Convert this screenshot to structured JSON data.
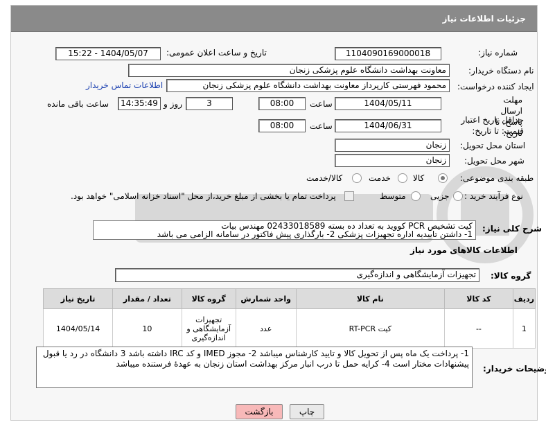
{
  "header": {
    "title": "جزئیات اطلاعات نیاز"
  },
  "form": {
    "need_number_label": "شماره نیاز:",
    "need_number": "1104090169000018",
    "announce_label": "تاریخ و ساعت اعلان عمومی:",
    "announce_value": "1404/05/07 - 15:22",
    "buyer_org_label": "نام دستگاه خریدار:",
    "buyer_org": "معاونت بهداشت دانشگاه علوم پزشکی زنجان",
    "creator_label": "ایجاد کننده درخواست:",
    "creator": "محمود فهرستی کارپرداز معاونت بهداشت دانشگاه علوم پزشکی زنجان",
    "contact_link": "اطلاعات تماس خریدار",
    "reply_deadline_label": "مهلت ارسال پاسخ: تا تاریخ:",
    "reply_date": "1404/05/11",
    "time_label": "ساعت",
    "reply_time": "08:00",
    "days": "3",
    "days_label": "روز و",
    "remaining_time": "14:35:49",
    "remaining_label": "ساعت باقی مانده",
    "price_validity_label": "حداقل تاریخ اعتبار قیمت: تا تاریخ:",
    "price_date": "1404/06/31",
    "price_time": "08:00",
    "province_label": "استان محل تحویل:",
    "province": "زنجان",
    "city_label": "شهر محل تحویل:",
    "city": "زنجان",
    "category_label": "طبقه بندی موضوعی:",
    "category_options": [
      "کالا",
      "خدمت",
      "کالا/خدمت"
    ],
    "process_label": "نوع فرآیند خرید :",
    "process_options": [
      "جزیی",
      "متوسط"
    ],
    "payment_note": "پرداخت تمام یا بخشی از مبلغ خرید،از محل \"اسناد خزانه اسلامی\" خواهد بود."
  },
  "summary": {
    "label": "شرح کلی نیاز:",
    "line1": "کیت تشخیص PCR کووید به تعداد ده بسته  02433018589 مهندس بیات",
    "line2": "1- داشتن تاییدیه اداره تجهیزات پزشکی 2- بارگذاری پیش فاکتور در سامانه الزامی می باشد"
  },
  "goods": {
    "section_title": "اطلاعات کالاهای مورد نیاز",
    "group_label": "گروه کالا:",
    "group_value": "تجهیزات آزمایشگاهی و اندازه‌گیری",
    "columns": [
      "ردیف",
      "کد کالا",
      "نام کالا",
      "واحد شمارش",
      "گروه کالا",
      "تعداد / مقدار",
      "تاریخ نیاز"
    ],
    "rows": [
      {
        "row": "1",
        "code": "--",
        "name": "کیت RT-PCR",
        "unit": "عدد",
        "group": "تجهیزات آزمایشگاهی و اندازه‌گیری",
        "qty": "10",
        "date": "1404/05/14"
      }
    ]
  },
  "buyer_notes": {
    "label": "توضیحات خریدار:",
    "text": "1- پرداخت یک ماه پس از تحویل کالا و تایید کارشناس میباشد 2-  مجوز IMED و کد IRC داشته باشد 3 دانشگاه در رد یا قبول پیشنهادات مختار است 4- کرایه حمل تا درب انبار مرکز بهداشت استان زنجان به عهدهٔ فرستنده میباشد"
  },
  "buttons": {
    "print": "چاپ",
    "back": "بازگشت"
  },
  "colors": {
    "header": "#8a8a8a",
    "link": "#1a3fb0",
    "back_button": "#f8b9b9"
  }
}
